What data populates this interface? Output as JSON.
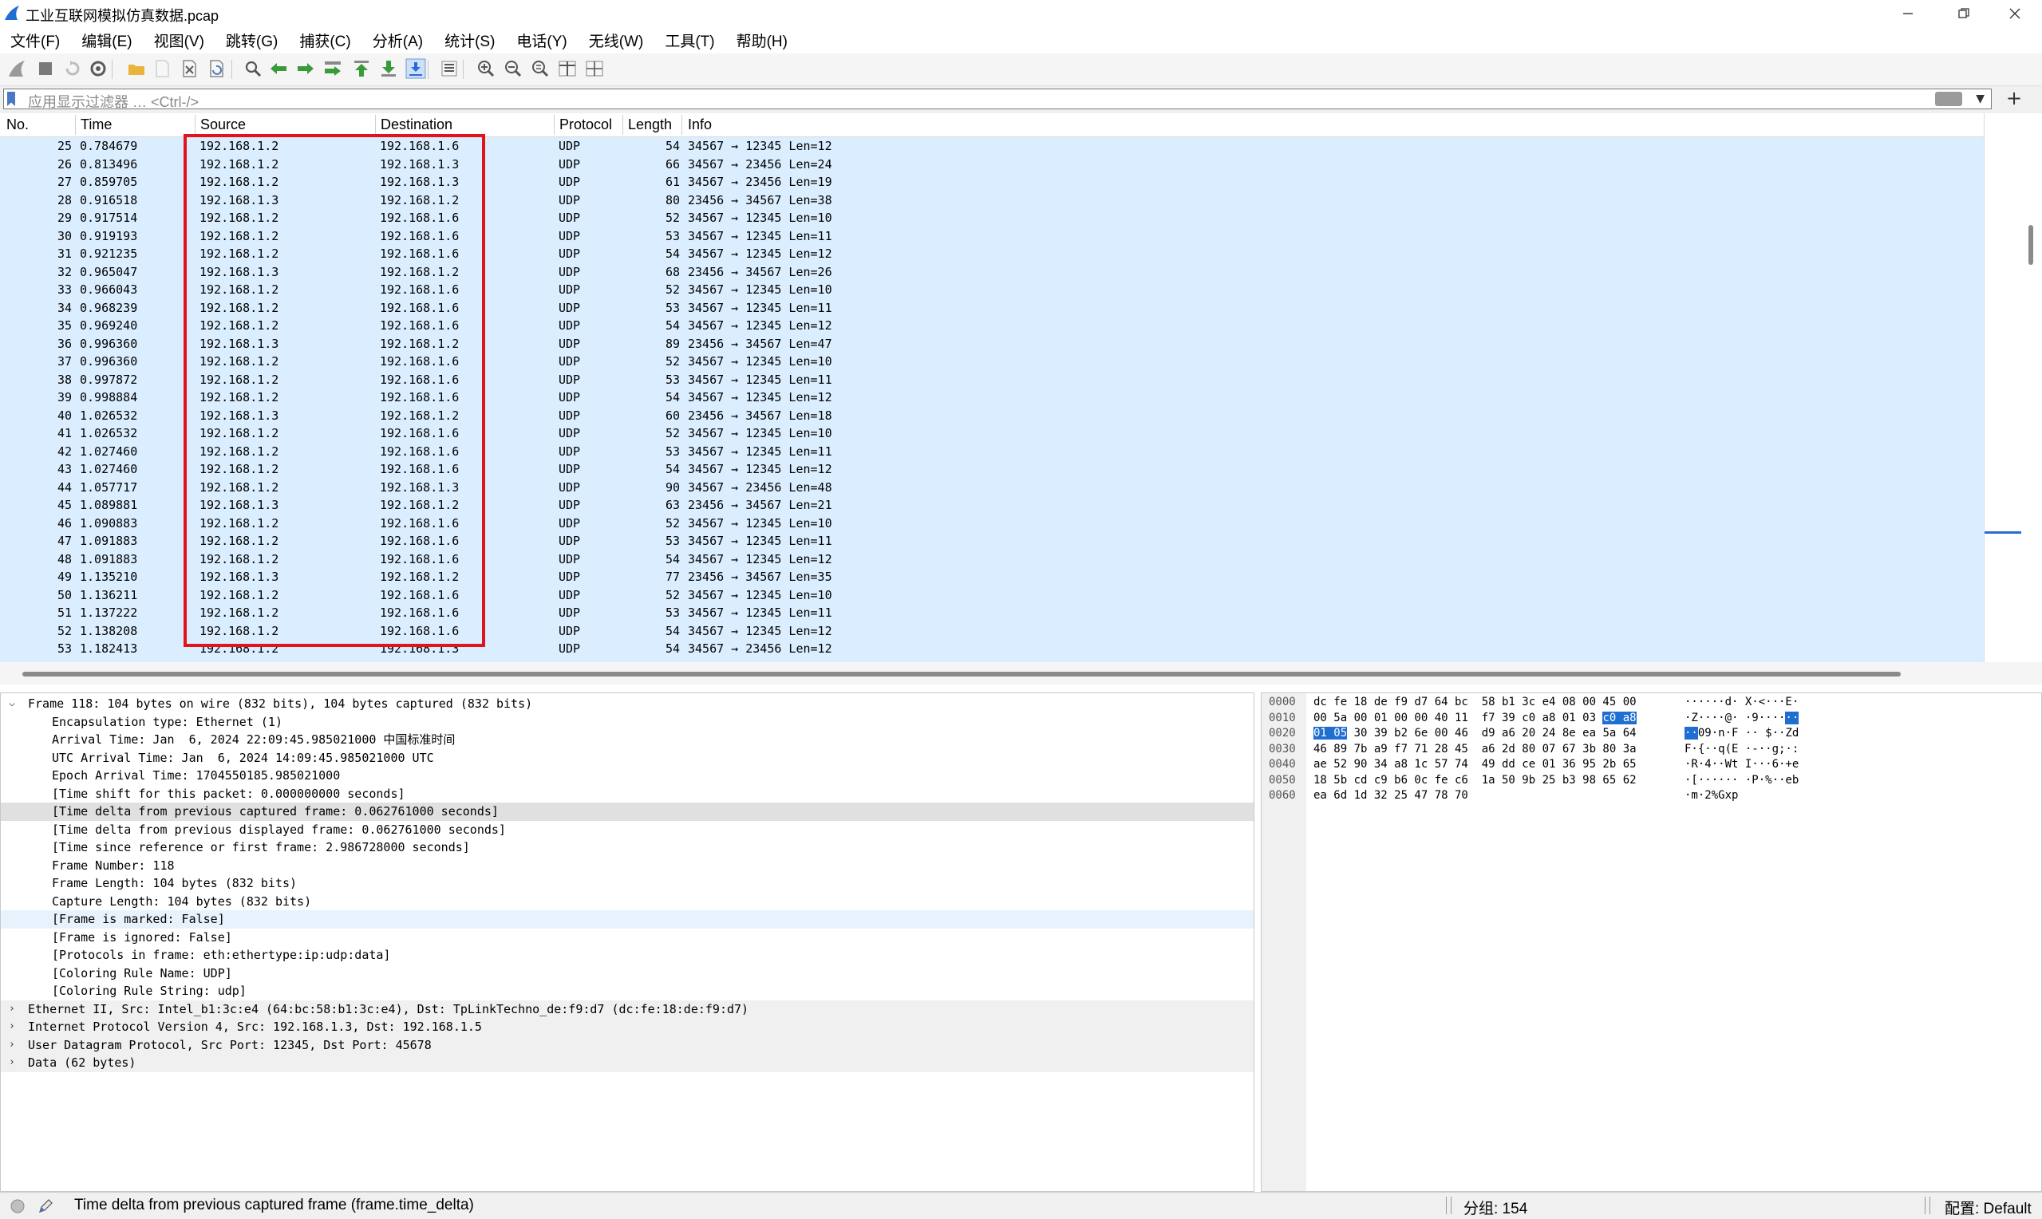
{
  "window": {
    "title": "工业互联网模拟仿真数据.pcap"
  },
  "menu": [
    "文件(F)",
    "编辑(E)",
    "视图(V)",
    "跳转(G)",
    "捕获(C)",
    "分析(A)",
    "统计(S)",
    "电话(Y)",
    "无线(W)",
    "工具(T)",
    "帮助(H)"
  ],
  "toolbar": [
    "shark-fin-start-icon",
    "stop-capture-icon",
    "restart-capture-icon",
    "capture-options-icon",
    "open-file-icon",
    "save-file-icon",
    "close-file-icon",
    "reload-file-icon",
    "find-packet-icon",
    "go-back-icon",
    "go-forward-icon",
    "go-to-packet-icon",
    "go-first-icon",
    "go-last-icon",
    "autoscroll-icon",
    "colorize-icon",
    "zoom-in-icon",
    "zoom-out-icon",
    "zoom-normal-icon",
    "resize-columns-icon",
    "layout-icon"
  ],
  "filter": {
    "placeholder": "应用显示过滤器 … <Ctrl-/>"
  },
  "packet_list": {
    "columns": [
      "No.",
      "Time",
      "Source",
      "Destination",
      "Protocol",
      "Length",
      "Info"
    ],
    "rows": [
      {
        "no": "25",
        "time": "0.784679",
        "src": "192.168.1.2",
        "dst": "192.168.1.6",
        "proto": "UDP",
        "len": "54",
        "info": "34567 → 12345 Len=12"
      },
      {
        "no": "26",
        "time": "0.813496",
        "src": "192.168.1.2",
        "dst": "192.168.1.3",
        "proto": "UDP",
        "len": "66",
        "info": "34567 → 23456 Len=24"
      },
      {
        "no": "27",
        "time": "0.859705",
        "src": "192.168.1.2",
        "dst": "192.168.1.3",
        "proto": "UDP",
        "len": "61",
        "info": "34567 → 23456 Len=19"
      },
      {
        "no": "28",
        "time": "0.916518",
        "src": "192.168.1.3",
        "dst": "192.168.1.2",
        "proto": "UDP",
        "len": "80",
        "info": "23456 → 34567 Len=38"
      },
      {
        "no": "29",
        "time": "0.917514",
        "src": "192.168.1.2",
        "dst": "192.168.1.6",
        "proto": "UDP",
        "len": "52",
        "info": "34567 → 12345 Len=10"
      },
      {
        "no": "30",
        "time": "0.919193",
        "src": "192.168.1.2",
        "dst": "192.168.1.6",
        "proto": "UDP",
        "len": "53",
        "info": "34567 → 12345 Len=11"
      },
      {
        "no": "31",
        "time": "0.921235",
        "src": "192.168.1.2",
        "dst": "192.168.1.6",
        "proto": "UDP",
        "len": "54",
        "info": "34567 → 12345 Len=12"
      },
      {
        "no": "32",
        "time": "0.965047",
        "src": "192.168.1.3",
        "dst": "192.168.1.2",
        "proto": "UDP",
        "len": "68",
        "info": "23456 → 34567 Len=26"
      },
      {
        "no": "33",
        "time": "0.966043",
        "src": "192.168.1.2",
        "dst": "192.168.1.6",
        "proto": "UDP",
        "len": "52",
        "info": "34567 → 12345 Len=10"
      },
      {
        "no": "34",
        "time": "0.968239",
        "src": "192.168.1.2",
        "dst": "192.168.1.6",
        "proto": "UDP",
        "len": "53",
        "info": "34567 → 12345 Len=11"
      },
      {
        "no": "35",
        "time": "0.969240",
        "src": "192.168.1.2",
        "dst": "192.168.1.6",
        "proto": "UDP",
        "len": "54",
        "info": "34567 → 12345 Len=12"
      },
      {
        "no": "36",
        "time": "0.996360",
        "src": "192.168.1.3",
        "dst": "192.168.1.2",
        "proto": "UDP",
        "len": "89",
        "info": "23456 → 34567 Len=47"
      },
      {
        "no": "37",
        "time": "0.996360",
        "src": "192.168.1.2",
        "dst": "192.168.1.6",
        "proto": "UDP",
        "len": "52",
        "info": "34567 → 12345 Len=10"
      },
      {
        "no": "38",
        "time": "0.997872",
        "src": "192.168.1.2",
        "dst": "192.168.1.6",
        "proto": "UDP",
        "len": "53",
        "info": "34567 → 12345 Len=11"
      },
      {
        "no": "39",
        "time": "0.998884",
        "src": "192.168.1.2",
        "dst": "192.168.1.6",
        "proto": "UDP",
        "len": "54",
        "info": "34567 → 12345 Len=12"
      },
      {
        "no": "40",
        "time": "1.026532",
        "src": "192.168.1.3",
        "dst": "192.168.1.2",
        "proto": "UDP",
        "len": "60",
        "info": "23456 → 34567 Len=18"
      },
      {
        "no": "41",
        "time": "1.026532",
        "src": "192.168.1.2",
        "dst": "192.168.1.6",
        "proto": "UDP",
        "len": "52",
        "info": "34567 → 12345 Len=10"
      },
      {
        "no": "42",
        "time": "1.027460",
        "src": "192.168.1.2",
        "dst": "192.168.1.6",
        "proto": "UDP",
        "len": "53",
        "info": "34567 → 12345 Len=11"
      },
      {
        "no": "43",
        "time": "1.027460",
        "src": "192.168.1.2",
        "dst": "192.168.1.6",
        "proto": "UDP",
        "len": "54",
        "info": "34567 → 12345 Len=12"
      },
      {
        "no": "44",
        "time": "1.057717",
        "src": "192.168.1.2",
        "dst": "192.168.1.3",
        "proto": "UDP",
        "len": "90",
        "info": "34567 → 23456 Len=48"
      },
      {
        "no": "45",
        "time": "1.089881",
        "src": "192.168.1.3",
        "dst": "192.168.1.2",
        "proto": "UDP",
        "len": "63",
        "info": "23456 → 34567 Len=21"
      },
      {
        "no": "46",
        "time": "1.090883",
        "src": "192.168.1.2",
        "dst": "192.168.1.6",
        "proto": "UDP",
        "len": "52",
        "info": "34567 → 12345 Len=10"
      },
      {
        "no": "47",
        "time": "1.091883",
        "src": "192.168.1.2",
        "dst": "192.168.1.6",
        "proto": "UDP",
        "len": "53",
        "info": "34567 → 12345 Len=11"
      },
      {
        "no": "48",
        "time": "1.091883",
        "src": "192.168.1.2",
        "dst": "192.168.1.6",
        "proto": "UDP",
        "len": "54",
        "info": "34567 → 12345 Len=12"
      },
      {
        "no": "49",
        "time": "1.135210",
        "src": "192.168.1.3",
        "dst": "192.168.1.2",
        "proto": "UDP",
        "len": "77",
        "info": "23456 → 34567 Len=35"
      },
      {
        "no": "50",
        "time": "1.136211",
        "src": "192.168.1.2",
        "dst": "192.168.1.6",
        "proto": "UDP",
        "len": "52",
        "info": "34567 → 12345 Len=10"
      },
      {
        "no": "51",
        "time": "1.137222",
        "src": "192.168.1.2",
        "dst": "192.168.1.6",
        "proto": "UDP",
        "len": "53",
        "info": "34567 → 12345 Len=11"
      },
      {
        "no": "52",
        "time": "1.138208",
        "src": "192.168.1.2",
        "dst": "192.168.1.6",
        "proto": "UDP",
        "len": "54",
        "info": "34567 → 12345 Len=12"
      },
      {
        "no": "53",
        "time": "1.182413",
        "src": "192.168.1.2",
        "dst": "192.168.1.3",
        "proto": "UDP",
        "len": "54",
        "info": "34567 → 23456 Len=12"
      }
    ]
  },
  "details": {
    "lines": [
      {
        "text": "Frame 118: 104 bytes on wire (832 bits), 104 bytes captured (832 bits)",
        "arrow": "expanded",
        "level": 0,
        "state": ""
      },
      {
        "text": "Encapsulation type: Ethernet (1)",
        "arrow": "",
        "level": 1,
        "state": ""
      },
      {
        "text": "Arrival Time: Jan  6, 2024 22:09:45.985021000 中国标准时间",
        "arrow": "",
        "level": 1,
        "state": ""
      },
      {
        "text": "UTC Arrival Time: Jan  6, 2024 14:09:45.985021000 UTC",
        "arrow": "",
        "level": 1,
        "state": ""
      },
      {
        "text": "Epoch Arrival Time: 1704550185.985021000",
        "arrow": "",
        "level": 1,
        "state": ""
      },
      {
        "text": "[Time shift for this packet: 0.000000000 seconds]",
        "arrow": "",
        "level": 1,
        "state": ""
      },
      {
        "text": "[Time delta from previous captured frame: 0.062761000 seconds]",
        "arrow": "",
        "level": 1,
        "state": "selected"
      },
      {
        "text": "[Time delta from previous displayed frame: 0.062761000 seconds]",
        "arrow": "",
        "level": 1,
        "state": ""
      },
      {
        "text": "[Time since reference or first frame: 2.986728000 seconds]",
        "arrow": "",
        "level": 1,
        "state": ""
      },
      {
        "text": "Frame Number: 118",
        "arrow": "",
        "level": 1,
        "state": ""
      },
      {
        "text": "Frame Length: 104 bytes (832 bits)",
        "arrow": "",
        "level": 1,
        "state": ""
      },
      {
        "text": "Capture Length: 104 bytes (832 bits)",
        "arrow": "",
        "level": 1,
        "state": ""
      },
      {
        "text": "[Frame is marked: False]",
        "arrow": "",
        "level": 1,
        "state": "marked"
      },
      {
        "text": "[Frame is ignored: False]",
        "arrow": "",
        "level": 1,
        "state": ""
      },
      {
        "text": "[Protocols in frame: eth:ethertype:ip:udp:data]",
        "arrow": "",
        "level": 1,
        "state": ""
      },
      {
        "text": "[Coloring Rule Name: UDP]",
        "arrow": "",
        "level": 1,
        "state": ""
      },
      {
        "text": "[Coloring Rule String: udp]",
        "arrow": "",
        "level": 1,
        "state": ""
      },
      {
        "text": "Ethernet II, Src: Intel_b1:3c:e4 (64:bc:58:b1:3c:e4), Dst: TpLinkTechno_de:f9:d7 (dc:fe:18:de:f9:d7)",
        "arrow": "collapsed",
        "level": 0,
        "state": "section"
      },
      {
        "text": "Internet Protocol Version 4, Src: 192.168.1.3, Dst: 192.168.1.5",
        "arrow": "collapsed",
        "level": 0,
        "state": "section"
      },
      {
        "text": "User Datagram Protocol, Src Port: 12345, Dst Port: 45678",
        "arrow": "collapsed",
        "level": 0,
        "state": "section"
      },
      {
        "text": "Data (62 bytes)",
        "arrow": "collapsed",
        "level": 0,
        "state": "section"
      }
    ]
  },
  "bytes": {
    "rows": [
      {
        "offset": "0000",
        "hex": [
          [
            "dc fe 18 de f9 d7 64 bc  58 b1 3c e4 08 00 45 00",
            false
          ]
        ],
        "ascii": [
          [
            "······d· X·<···E·",
            false
          ]
        ]
      },
      {
        "offset": "0010",
        "hex": [
          [
            "00 5a 00 01 00 00 40 11  f7 39 c0 a8 01 03 ",
            false
          ],
          [
            "c0 a8",
            true
          ]
        ],
        "ascii": [
          [
            "·Z····@· ·9····",
            false
          ],
          [
            "··",
            true
          ]
        ]
      },
      {
        "offset": "0020",
        "hex": [
          [
            "01 05",
            true
          ],
          [
            " 30 39 b2 6e 00 46  d9 a6 20 24 8e ea 5a 64",
            false
          ]
        ],
        "ascii": [
          [
            "··",
            true
          ],
          [
            "09·n·F ·· $··Zd",
            false
          ]
        ]
      },
      {
        "offset": "0030",
        "hex": [
          [
            "46 89 7b a9 f7 71 28 45  a6 2d 80 07 67 3b 80 3a",
            false
          ]
        ],
        "ascii": [
          [
            "F·{··q(E ·-··g;·:",
            false
          ]
        ]
      },
      {
        "offset": "0040",
        "hex": [
          [
            "ae 52 90 34 a8 1c 57 74  49 dd ce 01 36 95 2b 65",
            false
          ]
        ],
        "ascii": [
          [
            "·R·4··Wt I···6·+e",
            false
          ]
        ]
      },
      {
        "offset": "0050",
        "hex": [
          [
            "18 5b cd c9 b6 0c fe c6  1a 50 9b 25 b3 98 65 62",
            false
          ]
        ],
        "ascii": [
          [
            "·[······ ·P·%··eb",
            false
          ]
        ]
      },
      {
        "offset": "0060",
        "hex": [
          [
            "ea 6d 1d 32 25 47 78 70",
            false
          ]
        ],
        "ascii": [
          [
            "·m·2%Gxp",
            false
          ]
        ]
      }
    ]
  },
  "status": {
    "field_text": "Time delta from previous captured frame (frame.time_delta)",
    "packets": "分组: 154",
    "profile": "配置: Default"
  }
}
